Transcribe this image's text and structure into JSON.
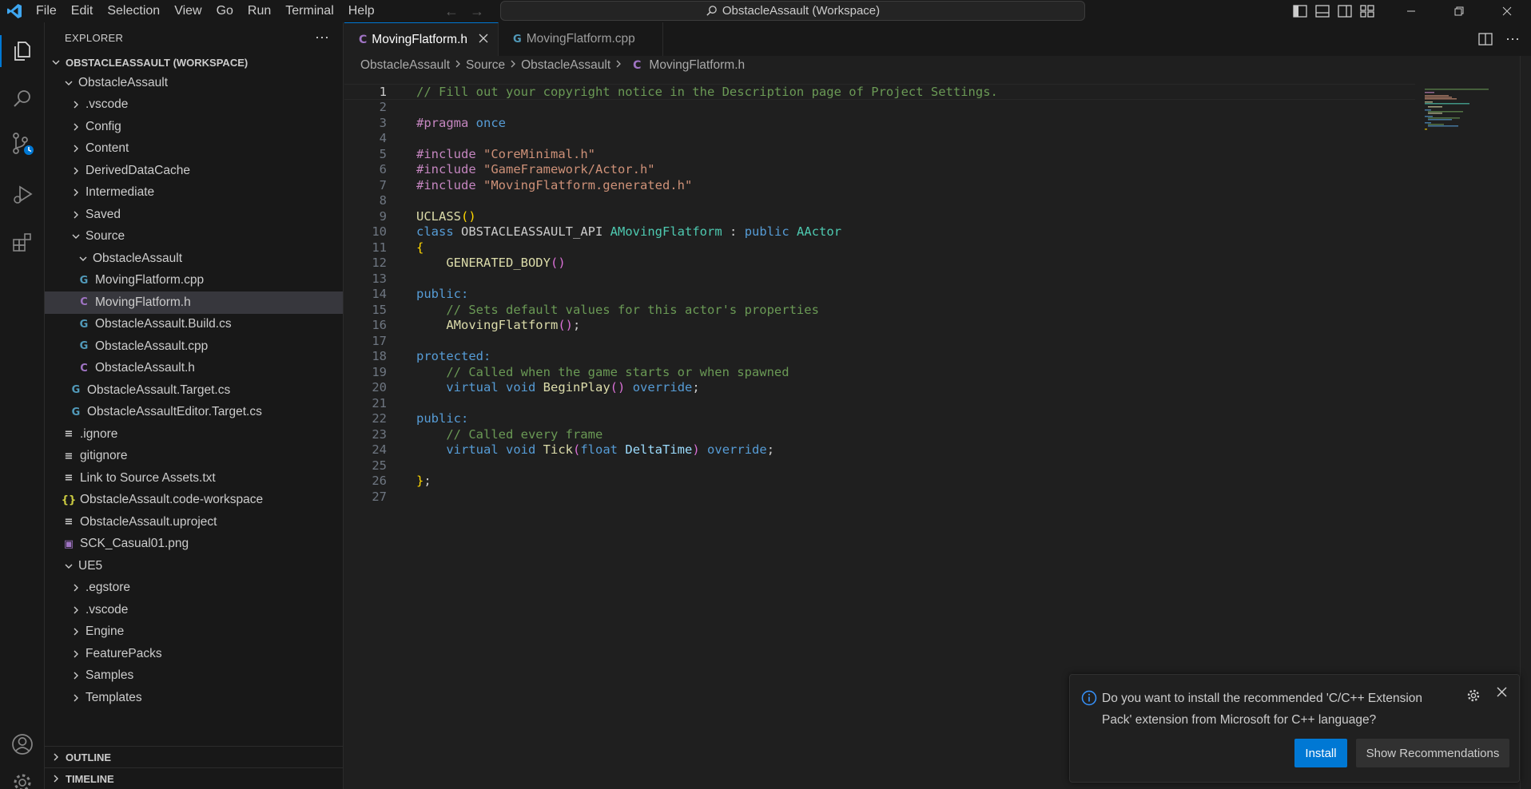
{
  "titlebar": {
    "menu": [
      "File",
      "Edit",
      "Selection",
      "View",
      "Go",
      "Run",
      "Terminal",
      "Help"
    ],
    "command_center": "ObstacleAssault (Workspace)"
  },
  "sidebar": {
    "title": "EXPLORER",
    "workspace": "OBSTACLEASSAULT (WORKSPACE)",
    "tree": [
      {
        "label": "ObstacleAssault",
        "kind": "folder-open"
      },
      {
        "label": ".vscode",
        "kind": "folder"
      },
      {
        "label": "Config",
        "kind": "folder"
      },
      {
        "label": "Content",
        "kind": "folder"
      },
      {
        "label": "DerivedDataCache",
        "kind": "folder"
      },
      {
        "label": "Intermediate",
        "kind": "folder"
      },
      {
        "label": "Saved",
        "kind": "folder"
      },
      {
        "label": "Source",
        "kind": "folder-open"
      },
      {
        "label": "ObstacleAssault",
        "kind": "folder-open"
      },
      {
        "label": "MovingFlatform.cpp",
        "kind": "cpp"
      },
      {
        "label": "MovingFlatform.h",
        "kind": "c"
      },
      {
        "label": "ObstacleAssault.Build.cs",
        "kind": "cpp"
      },
      {
        "label": "ObstacleAssault.cpp",
        "kind": "cpp"
      },
      {
        "label": "ObstacleAssault.h",
        "kind": "c"
      },
      {
        "label": "ObstacleAssault.Target.cs",
        "kind": "cpp"
      },
      {
        "label": "ObstacleAssaultEditor.Target.cs",
        "kind": "cpp"
      },
      {
        "label": ".ignore",
        "kind": "txt"
      },
      {
        "label": "gitignore",
        "kind": "txt"
      },
      {
        "label": "Link to Source Assets.txt",
        "kind": "txt"
      },
      {
        "label": "ObstacleAssault.code-workspace",
        "kind": "json"
      },
      {
        "label": "ObstacleAssault.uproject",
        "kind": "txt"
      },
      {
        "label": "SCK_Casual01.png",
        "kind": "img"
      },
      {
        "label": "UE5",
        "kind": "folder-open"
      },
      {
        "label": ".egstore",
        "kind": "folder"
      },
      {
        "label": ".vscode",
        "kind": "folder"
      },
      {
        "label": "Engine",
        "kind": "folder"
      },
      {
        "label": "FeaturePacks",
        "kind": "folder"
      },
      {
        "label": "Samples",
        "kind": "folder"
      },
      {
        "label": "Templates",
        "kind": "folder"
      }
    ],
    "outline": "OUTLINE",
    "timeline": "TIMELINE"
  },
  "tabs": [
    {
      "label": "MovingFlatform.h",
      "icon": "C"
    },
    {
      "label": "MovingFlatform.cpp",
      "icon": "C++"
    }
  ],
  "breadcrumb": [
    "ObstacleAssault",
    "Source",
    "ObstacleAssault",
    "MovingFlatform.h"
  ],
  "code": [
    "// Fill out your copyright notice in the Description page of Project Settings.",
    "",
    "#pragma once",
    "",
    "#include \"CoreMinimal.h\"",
    "#include \"GameFramework/Actor.h\"",
    "#include \"MovingFlatform.generated.h\"",
    "",
    "UCLASS()",
    "class OBSTACLEASSAULT_API AMovingFlatform : public AActor",
    "{",
    "    GENERATED_BODY()",
    "",
    "public:",
    "    // Sets default values for this actor's properties",
    "    AMovingFlatform();",
    "",
    "protected:",
    "    // Called when the game starts or when spawned",
    "    virtual void BeginPlay() override;",
    "",
    "public:",
    "    // Called every frame",
    "    virtual void Tick(float DeltaTime) override;",
    "",
    "};",
    ""
  ],
  "notification": {
    "message": "Do you want to install the recommended 'C/C++ Extension Pack' extension from Microsoft for C++ language?",
    "install_label": "Install",
    "recommendations_label": "Show Recommendations"
  },
  "colors": {
    "accent": "#0078d4",
    "background": "#1f1f1f",
    "sidebar": "#181818"
  }
}
